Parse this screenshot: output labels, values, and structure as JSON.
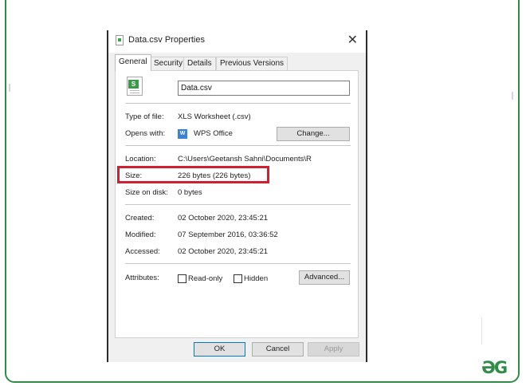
{
  "dialog": {
    "title": "Data.csv Properties",
    "close_glyph": "✕",
    "tabs": [
      "General",
      "Security",
      "Details",
      "Previous Versions"
    ],
    "file_icon_letter": "S",
    "filename": "Data.csv",
    "type_label": "Type of file:",
    "type_value": "XLS Worksheet (.csv)",
    "opens_label": "Opens with:",
    "opens_value": "WPS Office",
    "opens_icon_letter": "W",
    "change_label": "Change...",
    "location_label": "Location:",
    "location_value": "C:\\Users\\Geetansh Sahni\\Documents\\R",
    "size_label": "Size:",
    "size_value": "226 bytes (226 bytes)",
    "size_on_disk_label": "Size on disk:",
    "size_on_disk_value": "0 bytes",
    "created_label": "Created:",
    "created_value": "02 October 2020, 23:45:21",
    "modified_label": "Modified:",
    "modified_value": "07 September 2016, 03:36:52",
    "accessed_label": "Accessed:",
    "accessed_value": "02 October 2020, 23:45:21",
    "attributes_label": "Attributes:",
    "readonly_label": "Read-only",
    "hidden_label": "Hidden",
    "advanced_label": "Advanced...",
    "ok_label": "OK",
    "cancel_label": "Cancel",
    "apply_label": "Apply"
  },
  "logo_text": "ƏG",
  "colors": {
    "frame": "#2f8d46",
    "highlight": "#d02030",
    "ok_border": "#0078d7"
  }
}
